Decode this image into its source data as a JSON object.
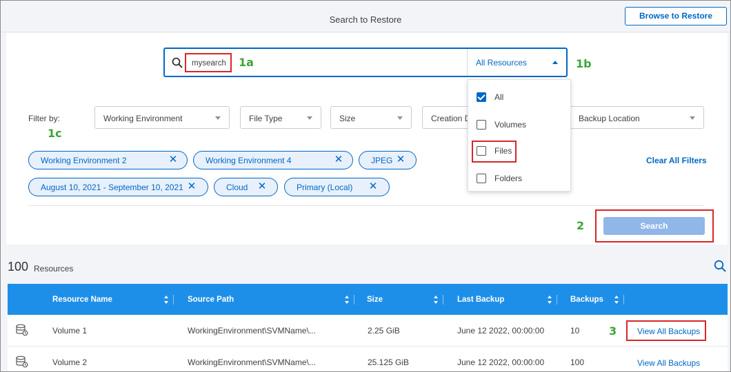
{
  "header": {
    "title": "Search to Restore",
    "browse_button": "Browse to Restore"
  },
  "search": {
    "query": "mysearch",
    "resource_type_selected": "All Resources",
    "resource_options": [
      {
        "label": "All",
        "checked": true
      },
      {
        "label": "Volumes",
        "checked": false
      },
      {
        "label": "Files",
        "checked": false
      },
      {
        "label": "Folders",
        "checked": false
      }
    ]
  },
  "annotations": {
    "a1a": "1a",
    "a1b": "1b",
    "a1c": "1c",
    "a2": "2",
    "a3": "3"
  },
  "filters": {
    "label": "Filter by:",
    "dropdowns": [
      "Working Environment",
      "File Type",
      "Size",
      "Creation D",
      "Backup Location"
    ],
    "chips": [
      "Working Environment 2",
      "Working Environment 4",
      "JPEG",
      "August 10, 2021 - September 10, 2021",
      "Cloud",
      "Primary (Local)"
    ],
    "clear_all": "Clear All Filters",
    "search_button": "Search"
  },
  "results": {
    "count": "100",
    "count_label": "Resources",
    "columns": [
      "Resource Name",
      "Source Path",
      "Size",
      "Last Backup",
      "Backups"
    ],
    "rows": [
      {
        "name": "Volume 1",
        "path": "WorkingEnvironment\\SVMName\\...",
        "size": "2.25 GiB",
        "last_backup": "June 12 2022, 00:00:00",
        "backups": "10",
        "action": "View All Backups"
      },
      {
        "name": "Volume 2",
        "path": "WorkingEnvironment\\SVMName\\...",
        "size": "25.125 GiB",
        "last_backup": "June 12 2022, 00:00:00",
        "backups": "100",
        "action": "View All Backups"
      }
    ]
  },
  "colors": {
    "accent": "#0067c5",
    "table_header": "#1e8fe8",
    "annotation_green": "#3aa635",
    "highlight_red": "#d72626",
    "disabled_button": "#91b6e8"
  }
}
